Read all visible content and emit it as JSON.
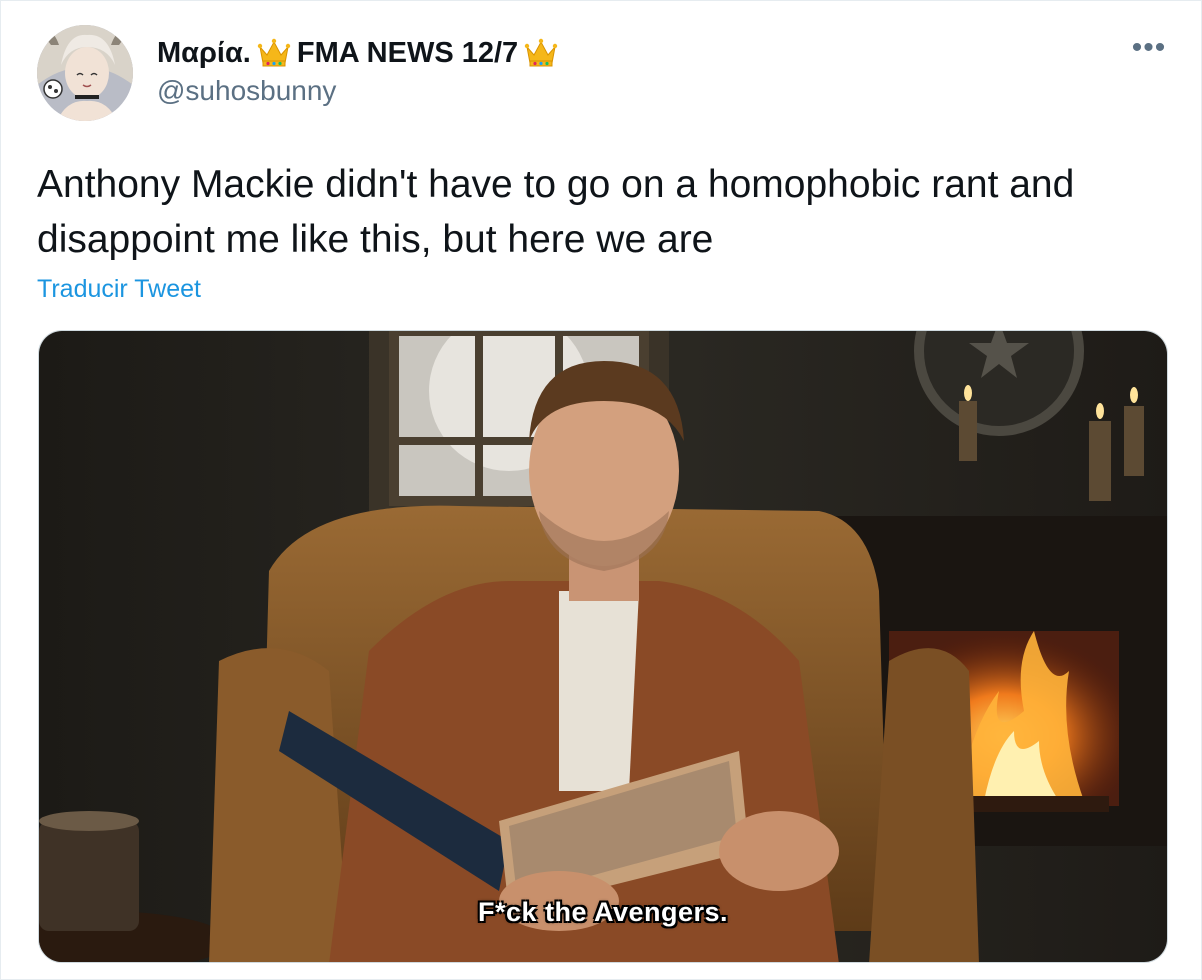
{
  "tweet": {
    "display_name": "Μαρία.",
    "name_suffix": "FMA NEWS 12/7",
    "handle": "@suhosbunny",
    "more_icon": "more-horizontal-icon",
    "crown_icon": "crown-emoji",
    "text": "Anthony Mackie didn't have to go on a homophobic rant and disappoint me like this, but here we are",
    "translate_label": "Traducir Tweet"
  },
  "media": {
    "caption": "F*ck the Avengers."
  },
  "colors": {
    "link": "#1b95e0",
    "secondary_text": "#5b7083",
    "primary_text": "#0f1419"
  }
}
